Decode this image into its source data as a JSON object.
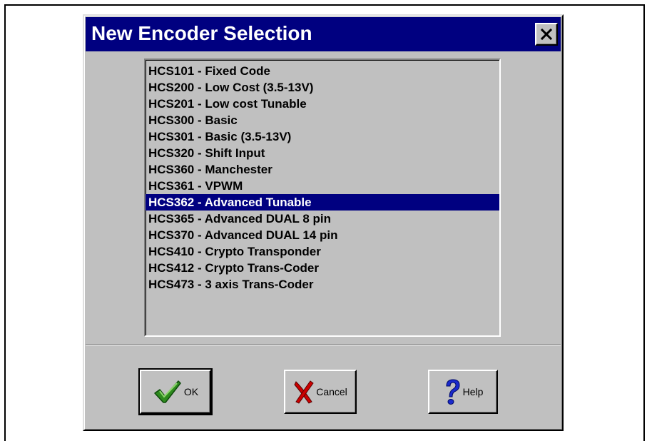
{
  "dialog": {
    "title": "New Encoder Selection",
    "close_icon": "close-icon"
  },
  "encoder_list": {
    "items": [
      {
        "label": "HCS101 - Fixed Code",
        "selected": false
      },
      {
        "label": "HCS200 - Low Cost (3.5-13V)",
        "selected": false
      },
      {
        "label": "HCS201 - Low cost Tunable",
        "selected": false
      },
      {
        "label": "HCS300 - Basic",
        "selected": false
      },
      {
        "label": "HCS301 - Basic (3.5-13V)",
        "selected": false
      },
      {
        "label": "HCS320 - Shift Input",
        "selected": false
      },
      {
        "label": "HCS360 - Manchester",
        "selected": false
      },
      {
        "label": "HCS361 - VPWM",
        "selected": false
      },
      {
        "label": "HCS362 - Advanced Tunable",
        "selected": true
      },
      {
        "label": "HCS365 - Advanced DUAL  8 pin",
        "selected": false
      },
      {
        "label": "HCS370 - Advanced DUAL 14 pin",
        "selected": false
      },
      {
        "label": "HCS410 - Crypto Transponder",
        "selected": false
      },
      {
        "label": "HCS412 - Crypto Trans-Coder",
        "selected": false
      },
      {
        "label": "HCS473 - 3 axis Trans-Coder",
        "selected": false
      }
    ],
    "selected_index": 8
  },
  "buttons": {
    "ok": {
      "label": "OK",
      "icon": "checkmark-icon"
    },
    "cancel": {
      "label": "Cancel",
      "icon": "red-x-icon"
    },
    "help": {
      "label": "Help",
      "icon": "question-mark-icon"
    }
  },
  "colors": {
    "titlebar": "#000080",
    "selection": "#000080",
    "face": "#c0c0c0",
    "ok_check": "#2e8b1e",
    "cancel_x": "#cc0000",
    "help_q": "#1a2acc"
  }
}
